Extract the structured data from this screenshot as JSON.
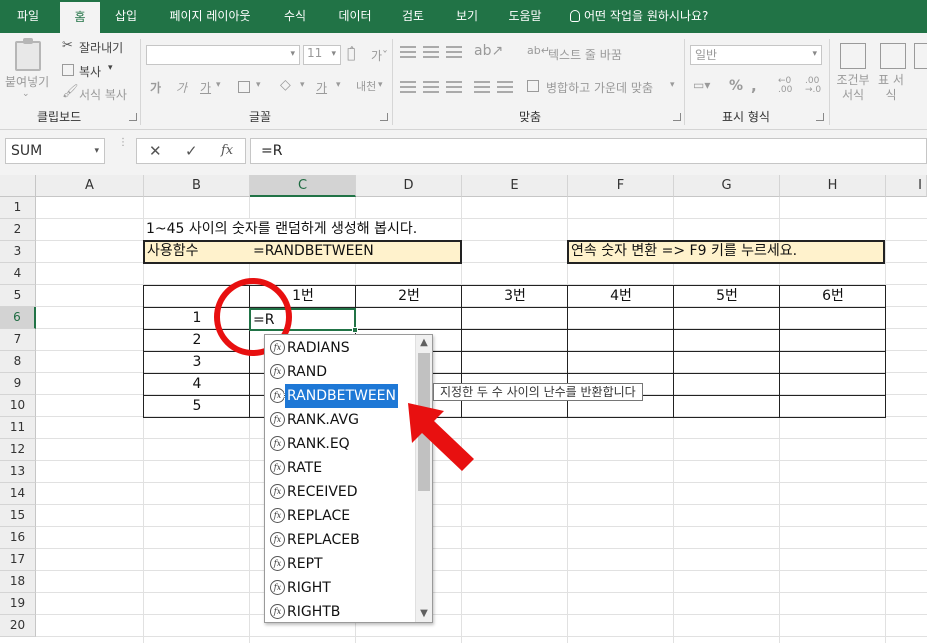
{
  "ribbon_tabs": [
    "파일",
    "홈",
    "삽입",
    "페이지 레이아웃",
    "수식",
    "데이터",
    "검토",
    "보기",
    "도움말"
  ],
  "tell_me": "어떤 작업을 원하시나요?",
  "clipboard": {
    "paste": "붙여넣기",
    "cut": "잘라내기",
    "copy": "복사",
    "format_painter": "서식 복사",
    "label": "클립보드"
  },
  "font": {
    "name": "",
    "size": "11",
    "bold": "가",
    "italic": "가",
    "underline": "가",
    "label": "글꼴"
  },
  "alignment": {
    "wrap": "텍스트 줄 바꿈",
    "merge": "병합하고 가운데 맞춤",
    "label": "맞춤"
  },
  "number": {
    "format": "일반",
    "label": "표시 형식"
  },
  "styles": {
    "conditional": "조건부 서식",
    "table": "표 서식"
  },
  "formula_bar": {
    "name_box": "SUM",
    "content": "=R"
  },
  "columns": [
    "A",
    "B",
    "C",
    "D",
    "E",
    "F",
    "G",
    "H",
    "I"
  ],
  "rows": [
    "1",
    "2",
    "3",
    "4",
    "5",
    "6",
    "7",
    "8",
    "9",
    "10",
    "11",
    "12",
    "13",
    "14",
    "15",
    "16",
    "17",
    "18",
    "19",
    "20"
  ],
  "sheet": {
    "title": "1~45 사이의 숫자를 랜덤하게 생성해 봅시다.",
    "func_label": "사용함수",
    "func_name": "=RANDBETWEEN",
    "tip": "연속 숫자 변환 => F9 키를 누르세요.",
    "table_headers": [
      "1번",
      "2번",
      "3번",
      "4번",
      "5번",
      "6번"
    ],
    "row_numbers": [
      "1",
      "2",
      "3",
      "4",
      "5"
    ],
    "editing": "=R"
  },
  "autocomplete": {
    "items": [
      "RADIANS",
      "RAND",
      "RANDBETWEEN",
      "RANK.AVG",
      "RANK.EQ",
      "RATE",
      "RECEIVED",
      "REPLACE",
      "REPLACEB",
      "REPT",
      "RIGHT",
      "RIGHTB"
    ],
    "selected": "RANDBETWEEN",
    "tooltip": "지정한 두 수 사이의 난수를 반환합니다"
  },
  "colors": {
    "excel_green": "#217346",
    "highlight": "#fff2cc",
    "annotation": "#e81010",
    "selection": "#1e78d6"
  }
}
